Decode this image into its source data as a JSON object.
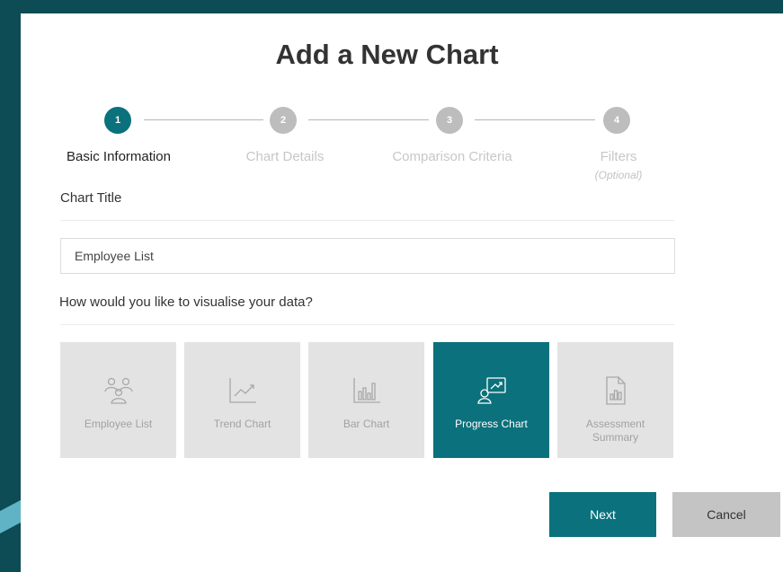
{
  "modal": {
    "title": "Add a New Chart"
  },
  "steps": [
    {
      "number": "1",
      "label": "Basic Information",
      "active": true
    },
    {
      "number": "2",
      "label": "Chart Details",
      "active": false
    },
    {
      "number": "3",
      "label": "Comparison Criteria",
      "active": false
    },
    {
      "number": "4",
      "label": "Filters",
      "note": "(Optional)",
      "active": false
    }
  ],
  "form": {
    "chart_title_label": "Chart Title",
    "chart_title_value": "Employee List",
    "visualise_label": "How would you like to visualise your data?"
  },
  "chart_types": [
    {
      "label": "Employee List",
      "icon": "people-icon",
      "selected": false
    },
    {
      "label": "Trend Chart",
      "icon": "trend-line-icon",
      "selected": false
    },
    {
      "label": "Bar Chart",
      "icon": "bar-chart-icon",
      "selected": false
    },
    {
      "label": "Progress Chart",
      "icon": "progress-chart-icon",
      "selected": true
    },
    {
      "label": "Assessment Summary",
      "icon": "document-chart-icon",
      "selected": false
    }
  ],
  "buttons": {
    "next": "Next",
    "cancel": "Cancel"
  },
  "colors": {
    "accent": "#0b717c",
    "background": "#0d4b55",
    "tile_bg": "#e3e3e3",
    "inactive_step": "#bdbdbd"
  }
}
